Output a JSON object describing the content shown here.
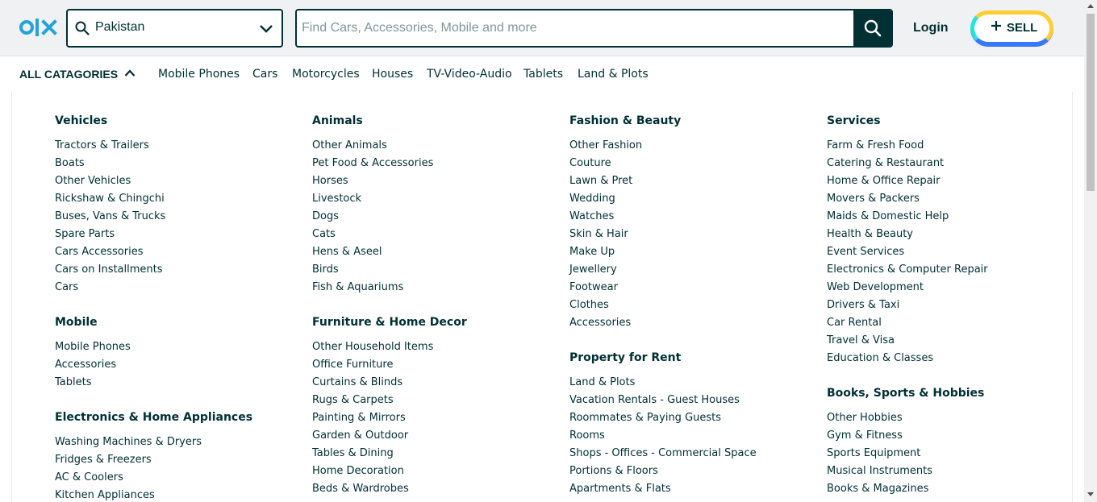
{
  "header": {
    "location_value": "Pakistan",
    "search_placeholder": "Find Cars, Accessories, Mobile and more",
    "login_label": "Login",
    "sell_label": "SELL"
  },
  "catbar": {
    "all_label": "ALL CATAGORIES",
    "quick_links": [
      "Mobile Phones",
      "Cars",
      "Motorcycles",
      "Houses",
      "TV-Video-Audio",
      "Tablets",
      "Land & Plots"
    ]
  },
  "columns": [
    {
      "groups": [
        {
          "title": "Vehicles",
          "items": [
            "Tractors & Trailers",
            "Boats",
            "Other Vehicles",
            "Rickshaw & Chingchi",
            "Buses, Vans & Trucks",
            "Spare Parts",
            "Cars Accessories",
            "Cars on Installments",
            "Cars"
          ]
        },
        {
          "title": "Mobile",
          "items": [
            "Mobile Phones",
            "Accessories",
            "Tablets"
          ]
        },
        {
          "title": "Electronics & Home Appliances",
          "items": [
            "Washing Machines & Dryers",
            "Fridges & Freezers",
            "AC & Coolers",
            "Kitchen Appliances"
          ]
        }
      ]
    },
    {
      "groups": [
        {
          "title": "Animals",
          "items": [
            "Other Animals",
            "Pet Food & Accessories",
            "Horses",
            "Livestock",
            "Dogs",
            "Cats",
            "Hens & Aseel",
            "Birds",
            "Fish & Aquariums"
          ]
        },
        {
          "title": "Furniture & Home Decor",
          "items": [
            "Other Household Items",
            "Office Furniture",
            "Curtains & Blinds",
            "Rugs & Carpets",
            "Painting & Mirrors",
            "Garden & Outdoor",
            "Tables & Dining",
            "Home Decoration",
            "Beds & Wardrobes"
          ]
        }
      ]
    },
    {
      "groups": [
        {
          "title": "Fashion & Beauty",
          "items": [
            "Other Fashion",
            "Couture",
            "Lawn & Pret",
            "Wedding",
            "Watches",
            "Skin & Hair",
            "Make Up",
            "Jewellery",
            "Footwear",
            "Clothes",
            "Accessories"
          ]
        },
        {
          "title": "Property for Rent",
          "items": [
            "Land & Plots",
            "Vacation Rentals - Guest Houses",
            "Roommates & Paying Guests",
            "Rooms",
            "Shops - Offices - Commercial Space",
            "Portions & Floors",
            "Apartments & Flats"
          ]
        }
      ]
    },
    {
      "groups": [
        {
          "title": "Services",
          "items": [
            "Farm & Fresh Food",
            "Catering & Restaurant",
            "Home & Office Repair",
            "Movers & Packers",
            "Maids & Domestic Help",
            "Health & Beauty",
            "Event Services",
            "Electronics & Computer Repair",
            "Web Development",
            "Drivers & Taxi",
            "Car Rental",
            "Travel & Visa",
            "Education & Classes"
          ]
        },
        {
          "title": "Books, Sports & Hobbies",
          "items": [
            "Other Hobbies",
            "Gym & Fitness",
            "Sports Equipment",
            "Musical Instruments",
            "Books & Magazines"
          ]
        }
      ]
    }
  ],
  "colors": {
    "brand": "#002f34",
    "sell_yellow": "#ffce32",
    "sell_blue": "#3a77ff",
    "sell_teal": "#23e5db",
    "header_bg": "#eff1f3"
  }
}
